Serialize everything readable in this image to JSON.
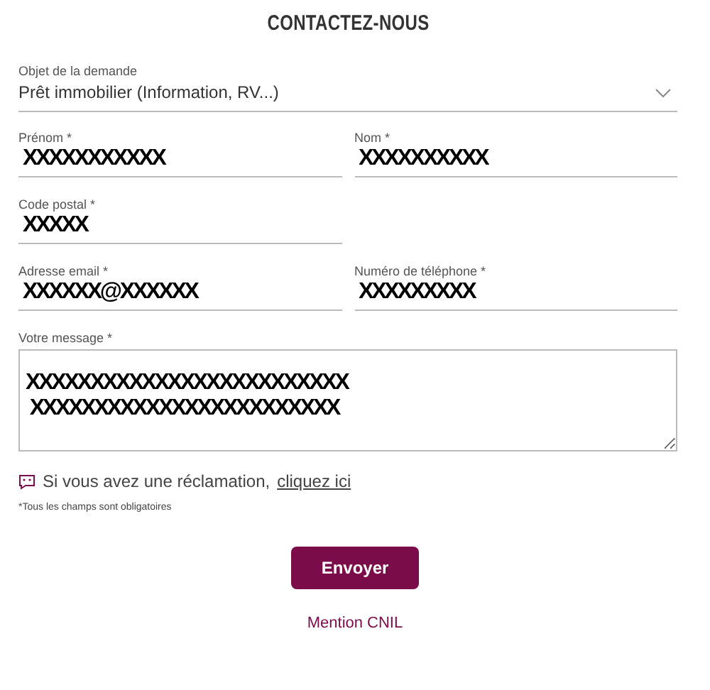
{
  "title": "CONTACTEZ-NOUS",
  "subject": {
    "label": "Objet de la demande",
    "value": "Prêt immobilier (Information, RV...)"
  },
  "fields": [
    {
      "label": "Prénom *",
      "value": "XXXXXXXXXXX"
    },
    {
      "label": "Nom *",
      "value": "XXXXXXXXXX"
    },
    {
      "label": "Code postal *",
      "value": "XXXXX"
    },
    {
      "label": "Adresse email *",
      "value": "XXXXXX@XXXXXX"
    },
    {
      "label": "Numéro de téléphone *",
      "value": "XXXXXXXXX"
    }
  ],
  "message": {
    "label": "Votre message *",
    "value": "XXXXXXXXXXXXXXXXXXXXXXXXX\n XXXXXXXXXXXXXXXXXXXXXXXX"
  },
  "complaint": {
    "text": "Si vous avez une réclamation,",
    "link": "cliquez ici"
  },
  "required_note": "*Tous les champs sont obligatoires",
  "submit": "Envoyer",
  "cnil_link": "Mention CNIL"
}
